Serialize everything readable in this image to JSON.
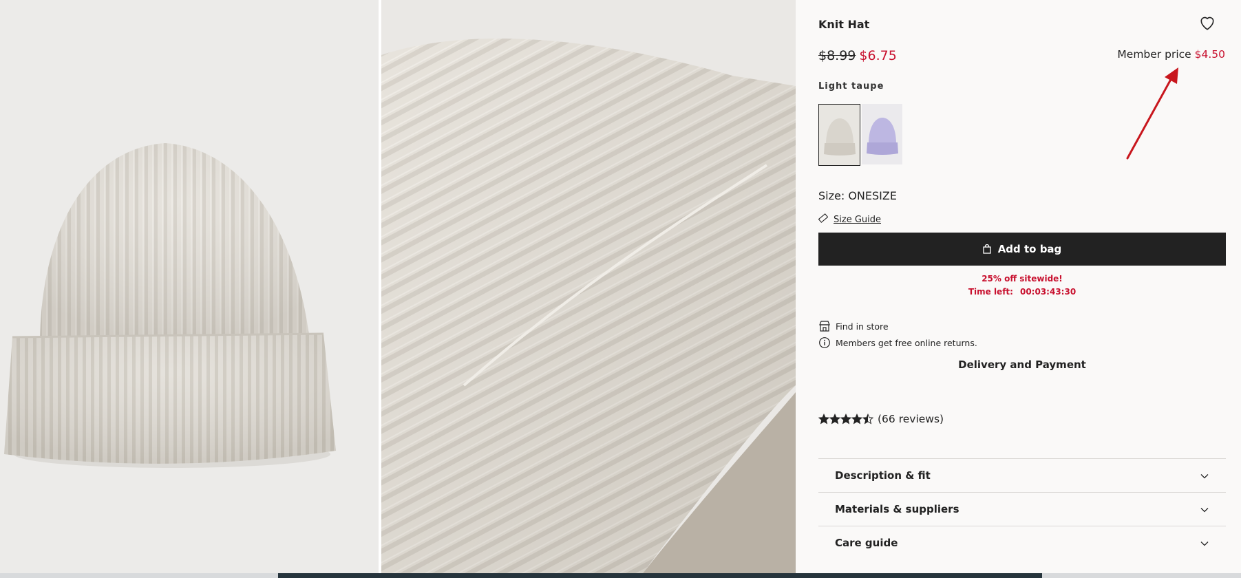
{
  "product": {
    "title": "Knit Hat",
    "old_price": "$8.99",
    "new_price": "$6.75",
    "member_label": "Member price",
    "member_price": "$4.50",
    "color_name": "Light taupe",
    "size_label": "Size: ONESIZE",
    "size_guide": "Size Guide",
    "add_to_bag": "Add to bag",
    "promo_line1": "25% off sitewide!",
    "promo_time_label": "Time left:",
    "promo_time_value": "00:03:43:30",
    "find_in_store": "Find in store",
    "returns_note": "Members get free online returns.",
    "delivery": "Delivery and Payment",
    "rating_value": 4.5,
    "reviews": "(66 reviews)"
  },
  "accordions": [
    {
      "label": "Description & fit"
    },
    {
      "label": "Materials & suppliers"
    },
    {
      "label": "Care guide"
    }
  ],
  "swatches": [
    {
      "name": "light-taupe",
      "color": "#d9d5cd",
      "selected": true
    },
    {
      "name": "lilac",
      "color": "#b9b3de",
      "selected": false
    }
  ],
  "colors": {
    "sale": "#c8102e",
    "button": "#222222",
    "annotation_arrow": "#c8161d"
  },
  "icons": [
    "heart-icon",
    "ruler-icon",
    "bag-icon",
    "store-icon",
    "info-icon",
    "star-icon",
    "chevron-down-icon"
  ]
}
